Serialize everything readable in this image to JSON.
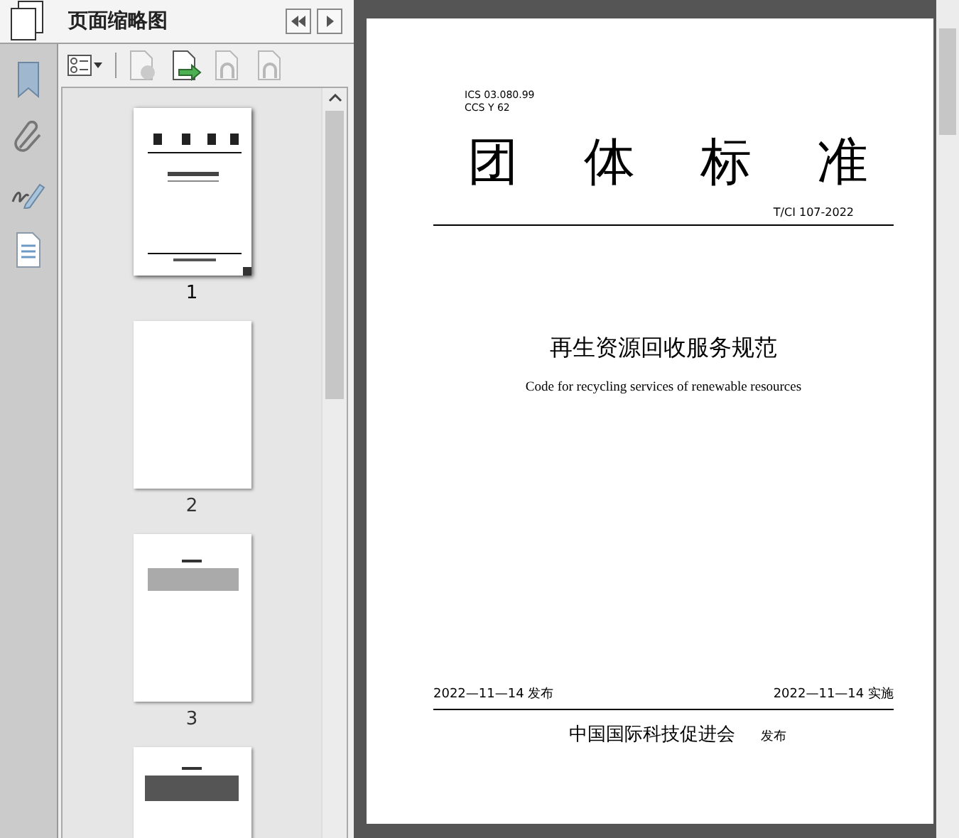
{
  "sidebar": {
    "title": "页面缩略图",
    "rail": [
      {
        "kind": "bookmark"
      },
      {
        "kind": "clip"
      },
      {
        "kind": "signature"
      },
      {
        "kind": "document"
      }
    ],
    "tools": [
      {
        "kind": "options",
        "disabled": false
      },
      {
        "kind": "delete",
        "disabled": true
      },
      {
        "kind": "insert",
        "disabled": false
      },
      {
        "kind": "undo",
        "disabled": true
      },
      {
        "kind": "redo",
        "disabled": true
      }
    ],
    "thumbnails": [
      {
        "kind": "cover",
        "label": "1",
        "selected": true
      },
      {
        "kind": "blank",
        "label": "2",
        "selected": false
      },
      {
        "kind": "contents",
        "label": "3",
        "selected": false
      },
      {
        "kind": "text",
        "selected": false
      }
    ]
  },
  "document": {
    "ics": "ICS  03.080.99",
    "ccs": "CCS  Y 62",
    "heading": [
      "团",
      "体",
      "标",
      "准"
    ],
    "code": "T/CI 107-2022",
    "title_cn": "再生资源回收服务规范",
    "title_en": "Code for recycling services of renewable resources",
    "publish_date": "2022—11—14 发布",
    "implement_date": "2022—11—14 实施",
    "publisher": "中国国际科技促进会",
    "publisher_note": "发布"
  }
}
